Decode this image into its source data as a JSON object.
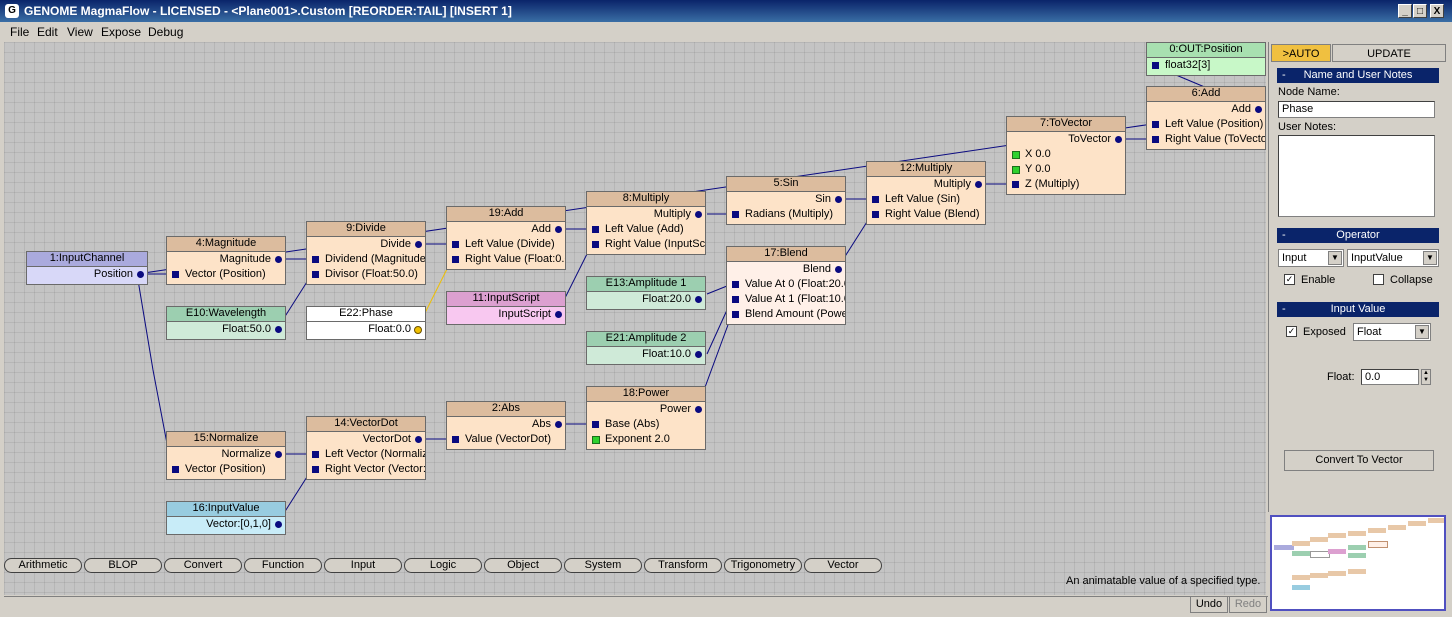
{
  "window": {
    "title": "GENOME MagmaFlow - LICENSED - <Plane001>.Custom [REORDER:TAIL] [INSERT 1]",
    "icon": "genome-logo-icon",
    "controls": {
      "minimize": "_",
      "maximize": "□",
      "close": "X"
    }
  },
  "menu": [
    "File",
    "Edit",
    "View",
    "Expose",
    "Debug"
  ],
  "nodes": {
    "input_channel": {
      "title": "1:InputChannel",
      "out": "Position"
    },
    "magnitude": {
      "title": "4:Magnitude",
      "out": "Magnitude",
      "in": [
        "Vector (Position)"
      ]
    },
    "divide": {
      "title": "9:Divide",
      "out": "Divide",
      "in": [
        "Dividend (Magnitude)",
        "Divisor (Float:50.0)"
      ]
    },
    "add19": {
      "title": "19:Add",
      "out": "Add",
      "in": [
        "Left Value (Divide)",
        "Right Value (Float:0.0"
      ]
    },
    "multiply8": {
      "title": "8:Multiply",
      "out": "Multiply",
      "in": [
        "Left Value (Add)",
        "Right Value (InputScri"
      ]
    },
    "sin": {
      "title": "5:Sin",
      "out": "Sin",
      "in": [
        "Radians (Multiply)"
      ]
    },
    "multiply12": {
      "title": "12:Multiply",
      "out": "Multiply",
      "in": [
        "Left Value (Sin)",
        "Right Value (Blend)"
      ]
    },
    "tovector": {
      "title": "7:ToVector",
      "out": "ToVector",
      "in": [
        "X 0.0",
        "Y 0.0",
        "Z (Multiply)"
      ]
    },
    "add6": {
      "title": "6:Add",
      "out": "Add",
      "in": [
        "Left Value (Position)",
        "Right Value (ToVecto"
      ]
    },
    "out_position": {
      "title": "0:OUT:Position",
      "in": [
        "float32[3]"
      ]
    },
    "wavelength": {
      "title": "E10:Wavelength",
      "out": "Float:50.0"
    },
    "phase": {
      "title": "E22:Phase",
      "out": "Float:0.0"
    },
    "inputscript": {
      "title": "11:InputScript",
      "out": "InputScript"
    },
    "amplitude1": {
      "title": "E13:Amplitude 1",
      "out": "Float:20.0"
    },
    "amplitude2": {
      "title": "E21:Amplitude 2",
      "out": "Float:10.0"
    },
    "blend": {
      "title": "17:Blend",
      "out": "Blend",
      "in": [
        "Value At 0 (Float:20.0",
        "Value At 1 (Float:10.0",
        "Blend Amount (Powe"
      ]
    },
    "normalize": {
      "title": "15:Normalize",
      "out": "Normalize",
      "in": [
        "Vector (Position)"
      ]
    },
    "vectordot": {
      "title": "14:VectorDot",
      "out": "VectorDot",
      "in": [
        "Left Vector (Normaliz",
        "Right Vector (Vector:"
      ]
    },
    "abs": {
      "title": "2:Abs",
      "out": "Abs",
      "in": [
        "Value (VectorDot)"
      ]
    },
    "power": {
      "title": "18:Power",
      "out": "Power",
      "in": [
        "Base (Abs)",
        "Exponent 2.0"
      ]
    },
    "inputvalue": {
      "title": "16:InputValue",
      "out": "Vector:[0,1,0]"
    }
  },
  "categories": [
    "Arithmetic",
    "BLOP",
    "Convert",
    "Function",
    "Input",
    "Logic",
    "Object",
    "System",
    "Transform",
    "Trigonometry",
    "Vector"
  ],
  "hint": "An animatable value of a specified type.",
  "status": {
    "undo": "Undo",
    "redo": "Redo"
  },
  "panel": {
    "auto": ">AUTO",
    "update": "UPDATE",
    "collapse_glyph": "-",
    "name_section": "Name and User Notes",
    "node_name_label": "Node Name:",
    "node_name_value": "Phase",
    "user_notes_label": "User Notes:",
    "operator_section": "Operator",
    "operator_category": "Input",
    "operator_type": "InputValue",
    "enable_label": "Enable",
    "collapse_label": "Collapse",
    "inputvalue_section": "Input Value",
    "exposed_label": "Exposed",
    "value_type": "Float",
    "float_label": "Float:",
    "float_value": "0.0",
    "convert_button": "Convert To Vector"
  },
  "colors": {
    "titlebar": "#0a246a",
    "node": "#fde3c8",
    "wire": "#0a0a80",
    "auto_tab": "#f0c040"
  }
}
